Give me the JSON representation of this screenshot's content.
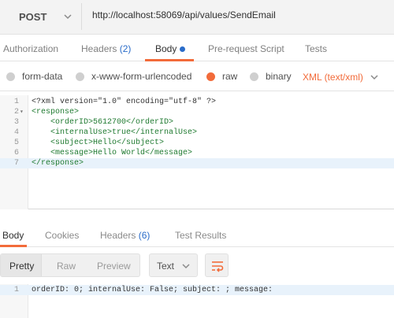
{
  "request": {
    "method": "POST",
    "url": "http://localhost:58069/api/values/SendEmail",
    "tabs": {
      "authorization": "Authorization",
      "headers": "Headers",
      "headers_count": "(2)",
      "body": "Body",
      "prerequest": "Pre-request Script",
      "tests": "Tests"
    },
    "body_types": {
      "form_data": "form-data",
      "urlencoded": "x-www-form-urlencoded",
      "raw": "raw",
      "binary": "binary",
      "selected": "raw",
      "content_type": "XML (text/xml)"
    },
    "editor": {
      "line_numbers": [
        "1",
        "2",
        "3",
        "4",
        "5",
        "6",
        "7"
      ],
      "lines": [
        {
          "pre": "<?xml version=\"1.0\" encoding=\"utf-8\" ?>"
        },
        {
          "pre": "<response>"
        },
        {
          "pre": "    <orderID>5612700</orderID>"
        },
        {
          "pre": "    <internalUse>true</internalUse>"
        },
        {
          "pre": "    <subject>Hello</subject>"
        },
        {
          "pre": "    <message>Hello World</message>"
        },
        {
          "pre": "</response>"
        }
      ],
      "current_line": 7
    }
  },
  "response": {
    "tabs": {
      "body": "Body",
      "cookies": "Cookies",
      "headers": "Headers",
      "headers_count": "(6)",
      "test_results": "Test Results"
    },
    "view_modes": {
      "pretty": "Pretty",
      "raw": "Raw",
      "preview": "Preview",
      "selected": "Pretty"
    },
    "format_select": "Text",
    "editor": {
      "line_number": "1",
      "text": "orderID: 0; internalUse: False; subject: ; message:"
    }
  },
  "icons": {
    "method_dropdown": "chevron-down-icon",
    "content_type_dropdown": "chevron-down-icon",
    "format_dropdown": "chevron-down-icon",
    "wrap": "wrap-lines-icon",
    "fold": "fold-arrow-icon"
  },
  "colors": {
    "accent": "#f26b3a",
    "link_blue": "#2a6cc9",
    "xml_tag": "#1f7a30"
  }
}
